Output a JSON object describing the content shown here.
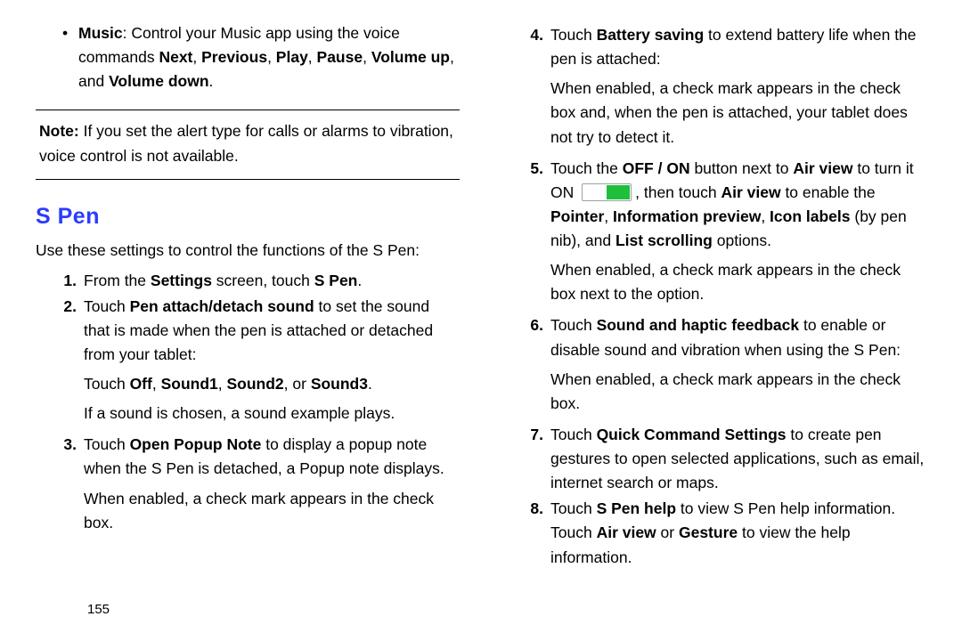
{
  "left": {
    "music_bullet": {
      "lead": "Music",
      "rest_a": ": Control your Music app using the voice commands ",
      "b1": "Next",
      "c1": ", ",
      "b2": "Previous",
      "c2": ", ",
      "b3": "Play",
      "c3": ", ",
      "b4": "Pause",
      "c4": ", ",
      "b5": "Volume up",
      "c5": ", and ",
      "b6": "Volume down",
      "c6": "."
    },
    "note": {
      "label": "Note:",
      "text": " If you set the alert type for calls or alarms to vibration, voice control is not available."
    },
    "heading": "S Pen",
    "intro": "Use these settings to control the functions of the S Pen:",
    "steps": {
      "s1": {
        "num": "1.",
        "a": "From the ",
        "b1": "Settings",
        "mid": " screen, touch ",
        "b2": "S Pen",
        "end": "."
      },
      "s2": {
        "num": "2.",
        "a": "Touch ",
        "b1": "Pen attach/detach sound",
        "rest": " to set the sound that is made when the pen is attached or detached from your tablet:",
        "sub1_a": "Touch ",
        "sub1_b1": "Off",
        "sub1_c1": ", ",
        "sub1_b2": "Sound1",
        "sub1_c2": ", ",
        "sub1_b3": "Sound2",
        "sub1_c3": ", or ",
        "sub1_b4": "Sound3",
        "sub1_c4": ".",
        "sub2": "If a sound is chosen, a sound example plays."
      },
      "s3": {
        "num": "3.",
        "a": "Touch ",
        "b1": "Open Popup Note",
        "rest": " to display a popup note when the S Pen is detached, a Popup note displays.",
        "sub": "When enabled, a check mark appears in the check box."
      }
    }
  },
  "right": {
    "s4": {
      "num": "4.",
      "a": "Touch ",
      "b1": "Battery saving",
      "rest": " to extend battery life when the pen is attached:",
      "sub": "When enabled, a check mark appears in the check box and, when the pen is attached, your tablet does not try to detect it."
    },
    "s5": {
      "num": "5.",
      "a": "Touch the ",
      "b1": "OFF / ON",
      "mid1": " button next to ",
      "b2": "Air view",
      "mid2": " to turn it ON ",
      "after_icon": ", then touch ",
      "b3": "Air view",
      "mid3": " to enable the ",
      "b4": "Pointer",
      "c1": ", ",
      "b5": "Information preview",
      "c2": ", ",
      "b6": "Icon labels",
      "paren": " (by pen nib), and ",
      "b7": "List scrolling",
      "end": " options.",
      "sub": "When enabled, a check mark appears in the check box next to the option."
    },
    "s6": {
      "num": "6.",
      "a": "Touch ",
      "b1": "Sound and haptic feedback",
      "rest": " to enable or disable sound and vibration when using the S Pen:",
      "sub": "When enabled, a check mark appears in the check box."
    },
    "s7": {
      "num": "7.",
      "a": "Touch ",
      "b1": "Quick Command Settings",
      "rest": " to create pen gestures to open selected applications, such as email, internet search or maps."
    },
    "s8": {
      "num": "8.",
      "a": "Touch ",
      "b1": "S Pen help",
      "mid": " to view S Pen help information. Touch ",
      "b2": "Air view",
      "or": " or ",
      "b3": "Gesture",
      "end": " to view the help information."
    }
  },
  "page_number": "155"
}
